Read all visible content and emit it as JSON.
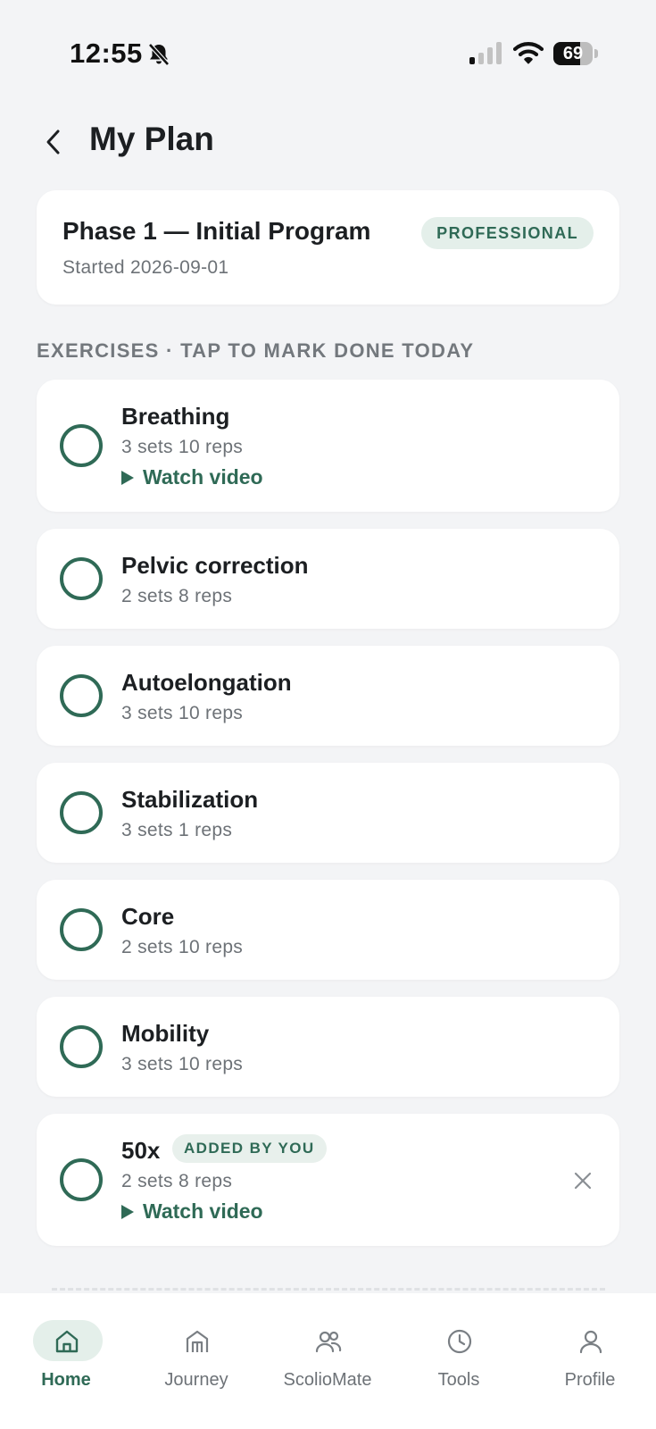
{
  "status_bar": {
    "time": "12:55",
    "battery": "69",
    "battery_level": 0.69
  },
  "header": {
    "title": "My Plan"
  },
  "plan": {
    "title": "Phase 1 — Initial Program",
    "started": "Started 2026-09-01",
    "badge": "PROFESSIONAL"
  },
  "section": {
    "title": "EXERCISES · TAP TO MARK DONE TODAY"
  },
  "exercises": [
    {
      "name": "Breathing",
      "detail": "3 sets 10 reps",
      "video": "Watch video"
    },
    {
      "name": "Pelvic correction",
      "detail": "2 sets 8 reps"
    },
    {
      "name": "Autoelongation",
      "detail": "3 sets 10 reps"
    },
    {
      "name": "Stabilization",
      "detail": "3 sets 1 reps"
    },
    {
      "name": "Core",
      "detail": "2 sets 10 reps"
    },
    {
      "name": "Mobility",
      "detail": "3 sets 10 reps"
    },
    {
      "name": "50x",
      "badge": "ADDED BY YOU",
      "detail": "2 sets 8 reps",
      "video": "Watch video"
    }
  ],
  "tabs": [
    {
      "label": "Home",
      "icon": "home-icon",
      "active": true
    },
    {
      "label": "Journey",
      "icon": "journey-icon",
      "active": false
    },
    {
      "label": "ScolioMate",
      "icon": "people-icon",
      "active": false
    },
    {
      "label": "Tools",
      "icon": "clock-icon",
      "active": false
    },
    {
      "label": "Profile",
      "icon": "person-icon",
      "active": false
    }
  ],
  "colors": {
    "accent": "#2f6a56",
    "background": "#f3f4f6",
    "card": "#ffffff",
    "muted_text": "#6d7277"
  }
}
